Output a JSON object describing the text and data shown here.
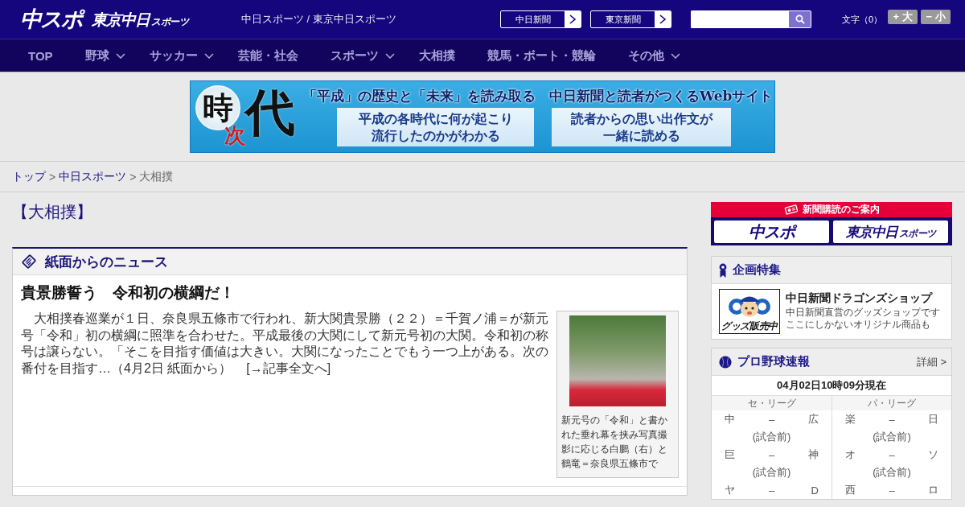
{
  "header": {
    "logos": [
      {
        "text": "中スポ"
      },
      {
        "text": "東京中日",
        "sub": "スポーツ"
      }
    ],
    "site_title": "中日スポーツ / 東京中日スポーツ",
    "paper_links": [
      "中日新聞",
      "東京新聞"
    ],
    "font_size": {
      "label": "文字（0）",
      "buttons": [
        "+ 大",
        "− 小"
      ]
    }
  },
  "nav": [
    {
      "label": "TOP",
      "dropdown": false
    },
    {
      "label": "野球",
      "dropdown": true
    },
    {
      "label": "サッカー",
      "dropdown": true
    },
    {
      "label": "芸能・社会",
      "dropdown": false
    },
    {
      "label": "スポーツ",
      "dropdown": true
    },
    {
      "label": "大相撲",
      "dropdown": false
    },
    {
      "label": "競馬・ボート・競輪",
      "dropdown": false
    },
    {
      "label": "その他",
      "dropdown": true
    }
  ],
  "banner": {
    "logo": [
      {
        "char": "時",
        "kind": "ring"
      },
      {
        "char": "次",
        "kind": "accent"
      },
      {
        "char": "代",
        "kind": "large"
      }
    ],
    "headline": "「平成」の歴史と「未来」を読み取る　中日新聞と読者がつくるWebサイト",
    "panels": [
      [
        "平成の各時代に何が起こり",
        "流行したのかがわかる"
      ],
      [
        "読者からの思い出作文が",
        "一緒に読める"
      ]
    ]
  },
  "breadcrumb": [
    {
      "label": "トップ",
      "kind": "link"
    },
    {
      "label": ">",
      "kind": "separator"
    },
    {
      "label": "中日スポーツ",
      "kind": "link"
    },
    {
      "label": ">",
      "kind": "separator"
    },
    {
      "label": "大相撲",
      "kind": "current"
    }
  ],
  "category_title": "【大相撲】",
  "news": {
    "heading": "紙面からのニュース",
    "title": "貴景勝誓う　令和初の横綱だ！",
    "body": "大相撲春巡業が１日、奈良県五條市で行われ、新大関貴景勝（２２）＝千賀ノ浦＝が新元号「令和」初の横綱に照準を合わせた。平成最後の大関にして新元号初の大関。令和初の称号は譲らない。「そこを目指す価値は大きい。大関になったことでもう一つ上がある。次の番付を目指す…（4月2日 紙面から）",
    "more_link": "[→記事全文へ]",
    "photo_caption": "新元号の「令和」と書かれた垂れ幕を挟み写真撮影に応じる白鵬（右）と鶴竜＝奈良県五條市で"
  },
  "sidebar": {
    "subscription": {
      "heading": "新聞購読のご案内",
      "logos": [
        {
          "text": "中スポ"
        },
        {
          "text": "東京中日",
          "sub": "スポーツ"
        }
      ]
    },
    "feature": {
      "heading": "企画特集",
      "thumb_label": "グッズ販売中",
      "title": "中日新聞ドラゴンズショップ",
      "lines": [
        "中日新聞直営のグッズショップです",
        "ここにしかないオリジナル商品も"
      ]
    },
    "baseball": {
      "heading": "プロ野球速報",
      "detail_link": "詳細 >",
      "updated": "04月02日10時09分現在",
      "leagues": [
        {
          "name": "セ・リーグ",
          "games": [
            {
              "home": "中",
              "score": "–",
              "away": "広",
              "status": "(試合前)"
            },
            {
              "home": "巨",
              "score": "–",
              "away": "神",
              "status": "(試合前)"
            },
            {
              "home": "ヤ",
              "score": "–",
              "away": "D"
            }
          ]
        },
        {
          "name": "パ・リーグ",
          "games": [
            {
              "home": "楽",
              "score": "–",
              "away": "日",
              "status": "(試合前)"
            },
            {
              "home": "オ",
              "score": "–",
              "away": "ソ",
              "status": "(試合前)"
            },
            {
              "home": "西",
              "score": "–",
              "away": "ロ"
            }
          ]
        }
      ]
    }
  }
}
